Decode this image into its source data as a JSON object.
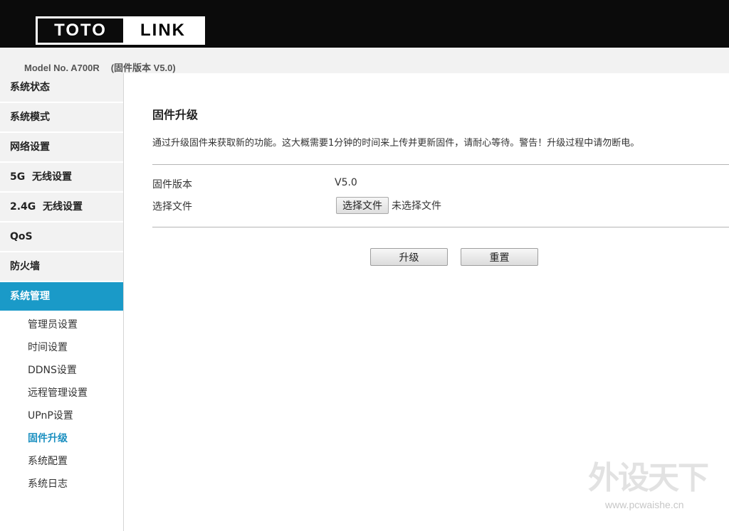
{
  "header": {
    "logo_left": "TOTO",
    "logo_right": "LINK",
    "model": "Model No. A700R",
    "firmware_version_label": "(固件版本 V5.0)"
  },
  "sidebar": {
    "items": [
      {
        "label": "系统状态"
      },
      {
        "label": "系统模式"
      },
      {
        "label": "网络设置"
      },
      {
        "label": "5G  无线设置"
      },
      {
        "label": "2.4G  无线设置"
      },
      {
        "label": "QoS"
      },
      {
        "label": "防火墙"
      },
      {
        "label": "系统管理",
        "active": true
      }
    ],
    "sub_items": [
      {
        "label": "管理员设置"
      },
      {
        "label": "时间设置"
      },
      {
        "label": "DDNS设置"
      },
      {
        "label": "远程管理设置"
      },
      {
        "label": "UPnP设置"
      },
      {
        "label": "固件升级",
        "active": true
      },
      {
        "label": "系统配置"
      },
      {
        "label": "系统日志"
      }
    ]
  },
  "main": {
    "title": "固件升级",
    "description": "通过升级固件来获取新的功能。这大概需要1分钟的时间来上传并更新固件，请耐心等待。警告！升级过程中请勿断电。",
    "firmware_label": "固件版本",
    "firmware_value": "V5.0",
    "file_label": "选择文件",
    "file_button": "选择文件",
    "file_status": "未选择文件",
    "upgrade_button": "升级",
    "reset_button": "重置"
  },
  "watermark": {
    "cn": "外设天下",
    "url": "www.pcwaishe.cn"
  },
  "colors": {
    "accent": "#1a9ac8",
    "topbar": "#0b0b0b"
  }
}
